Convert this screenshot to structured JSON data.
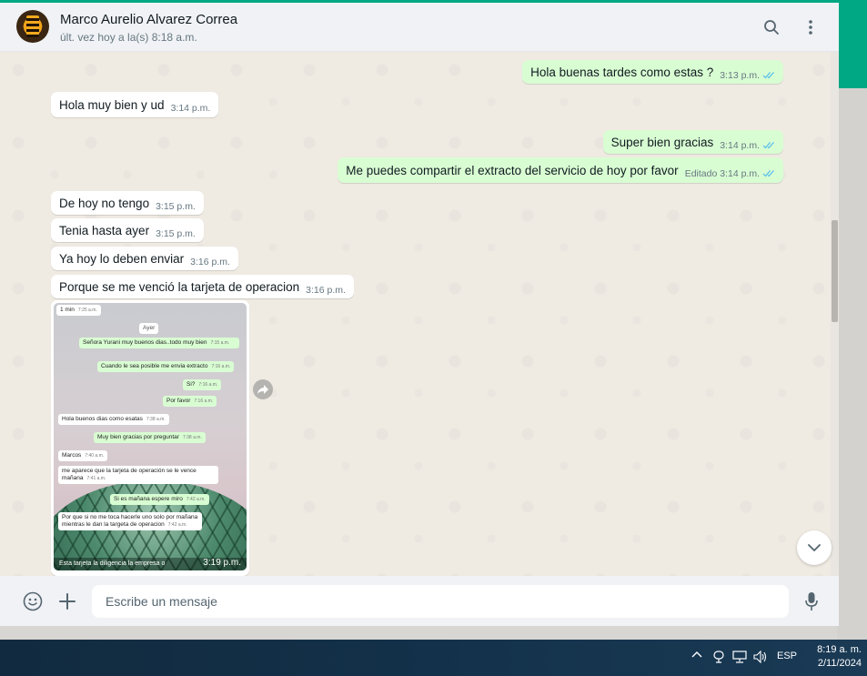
{
  "header": {
    "contact_name": "Marco Aurelio Alvarez Correa",
    "status": "últ. vez hoy a la(s) 8:18 a.m."
  },
  "messages": [
    {
      "dir": "out",
      "text": "Hola buenas tardes como estas ?",
      "time": "3:13 p.m."
    },
    {
      "dir": "in",
      "text": "Hola muy bien y ud",
      "time": "3:14 p.m."
    },
    {
      "dir": "out",
      "text": "Super bien gracias",
      "time": "3:14 p.m."
    },
    {
      "dir": "out",
      "text": "Me puedes compartir el extracto del servicio de hoy por favor",
      "time": "Editado 3:14 p.m."
    },
    {
      "dir": "in",
      "text": "De hoy no tengo",
      "time": "3:15 p.m."
    },
    {
      "dir": "in",
      "text": "Tenia hasta ayer",
      "time": "3:15 p.m."
    },
    {
      "dir": "in",
      "text": "Ya hoy lo deben enviar",
      "time": "3:16 p.m."
    },
    {
      "dir": "in",
      "text": "Porque se me venció la tarjeta de operacion",
      "time": "3:16 p.m."
    }
  ],
  "image_message": {
    "time": "3:19 p.m.",
    "caption": "Esta tarjeta la diligencia la empresa o",
    "inner": {
      "top_text": "1 min",
      "top_time": "7:25 a.m.",
      "day_label": "Ayer",
      "lines": [
        {
          "dir": "out",
          "text": "Señora Yurani muy buenos dias..todo muy bien",
          "time": "7:15 a.m."
        },
        {
          "dir": "out",
          "text": "Cuando le sea posible me envia extracto",
          "time": "7:16 a.m."
        },
        {
          "dir": "out",
          "text": "Si?",
          "time": "7:16 a.m."
        },
        {
          "dir": "out",
          "text": "Por favor",
          "time": "7:16 a.m."
        },
        {
          "dir": "in",
          "text": "Hola buenos dias como esatas",
          "time": "7:38 a.m."
        },
        {
          "dir": "out",
          "text": "Muy bien gracias por preguntar",
          "time": "7:38 a.m."
        },
        {
          "dir": "in",
          "text": "Marcos",
          "time": "7:40 a.m."
        },
        {
          "dir": "in",
          "text": "me aparece que la tarjeta de operación se le vence mañana",
          "time": "7:41 a.m."
        },
        {
          "dir": "out",
          "text": "Si es mañana espere miro",
          "time": "7:42 a.m."
        },
        {
          "dir": "in",
          "text": "Por que si no me toca hacerle uno solo por mañana mientras le dan la targeta de operacion",
          "time": "7:42 a.m."
        }
      ]
    }
  },
  "composer": {
    "placeholder": "Escribe un mensaje"
  },
  "taskbar": {
    "language": "ESP",
    "time": "8:19 a. m.",
    "date": "2/11/2024"
  },
  "icons": {
    "search": "search-icon",
    "menu": "kebab-menu-icon",
    "emoji": "emoji-icon",
    "attach": "plus-icon",
    "mic": "microphone-icon",
    "forward": "forward-icon",
    "scroll_down": "chevron-down-icon"
  },
  "colors": {
    "accent": "#00a884",
    "outgoing_bubble": "#d9fdd3",
    "incoming_bubble": "#ffffff",
    "chat_bg": "#efeae2",
    "read_ticks": "#53bdeb"
  }
}
